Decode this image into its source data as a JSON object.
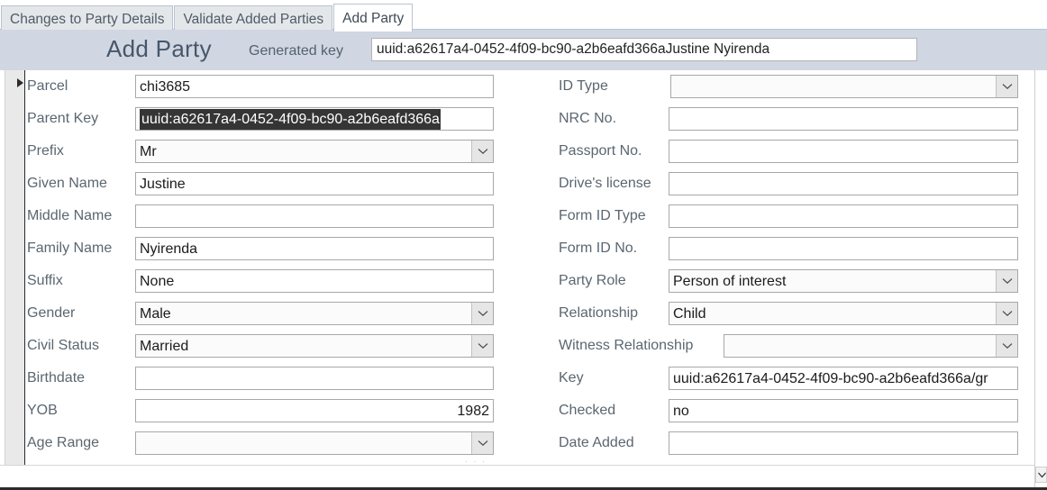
{
  "tabs": [
    {
      "label": "Changes to Party Details",
      "active": false
    },
    {
      "label": "Validate Added Parties",
      "active": false
    },
    {
      "label": "Add Party",
      "active": true
    }
  ],
  "header": {
    "title": "Add Party",
    "generated_key_label": "Generated key",
    "generated_key_value": "uuid:a62617a4-0452-4f09-bc90-a2b6eafd366aJustine Nyirenda"
  },
  "left_fields": [
    {
      "label": "Parcel",
      "value": "chi3685",
      "type": "text",
      "selected": false,
      "align": "left"
    },
    {
      "label": "Parent Key",
      "value": "uuid:a62617a4-0452-4f09-bc90-a2b6eafd366a",
      "type": "text",
      "selected": true,
      "align": "left"
    },
    {
      "label": "Prefix",
      "value": "Mr",
      "type": "combo",
      "selected": false,
      "align": "left"
    },
    {
      "label": "Given Name",
      "value": "Justine",
      "type": "text",
      "selected": false,
      "align": "left"
    },
    {
      "label": "Middle Name",
      "value": "",
      "type": "text",
      "selected": false,
      "align": "left"
    },
    {
      "label": "Family Name",
      "value": "Nyirenda",
      "type": "text",
      "selected": false,
      "align": "left"
    },
    {
      "label": "Suffix",
      "value": "None",
      "type": "text",
      "selected": false,
      "align": "left"
    },
    {
      "label": "Gender",
      "value": "Male",
      "type": "combo",
      "selected": false,
      "align": "left"
    },
    {
      "label": "Civil Status",
      "value": "Married",
      "type": "combo",
      "selected": false,
      "align": "left"
    },
    {
      "label": "Birthdate",
      "value": "",
      "type": "text",
      "selected": false,
      "align": "left"
    },
    {
      "label": "YOB",
      "value": "1982",
      "type": "text",
      "selected": false,
      "align": "right"
    },
    {
      "label": "Age Range",
      "value": "",
      "type": "combo",
      "selected": false,
      "align": "left"
    }
  ],
  "right_fields": [
    {
      "label": "ID Type",
      "value": "",
      "type": "combo"
    },
    {
      "label": "NRC No.",
      "value": "",
      "type": "text"
    },
    {
      "label": "Passport No.",
      "value": "",
      "type": "text"
    },
    {
      "label": "Drive's license",
      "value": "",
      "type": "text"
    },
    {
      "label": "Form ID Type",
      "value": "",
      "type": "text"
    },
    {
      "label": "Form ID No.",
      "value": "",
      "type": "text"
    },
    {
      "label": "Party Role",
      "value": "Person of interest",
      "type": "combo"
    },
    {
      "label": "Relationship",
      "value": "Child",
      "type": "combo"
    },
    {
      "label": "Witness Relationship",
      "value": "",
      "type": "combo"
    },
    {
      "label": "Key",
      "value": "uuid:a62617a4-0452-4f09-bc90-a2b6eafd366a/gr",
      "type": "text"
    },
    {
      "label": "Checked",
      "value": "no",
      "type": "text"
    },
    {
      "label": "Date Added",
      "value": "",
      "type": "text"
    }
  ],
  "icons": {
    "record_selector": "play-triangle-icon",
    "combo_arrow": "chevron-down-icon",
    "scroll_down": "scroll-down-arrow-icon"
  },
  "colors": {
    "header_band": "#d0d7e2",
    "title_text": "#47566b",
    "label_text": "#5b6670",
    "selection_bg": "#353535",
    "tab_inactive": "#e4e7ea"
  }
}
